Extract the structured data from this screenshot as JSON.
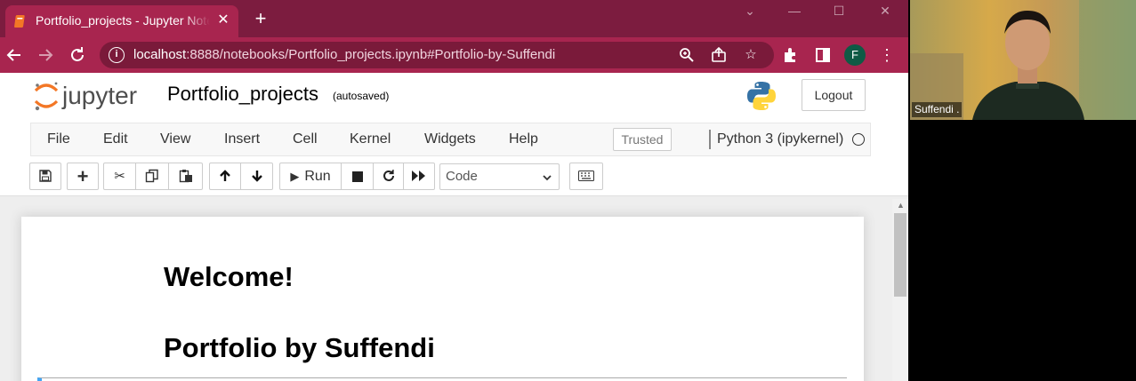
{
  "browser": {
    "tab_title": "Portfolio_projects - Jupyter Notebook",
    "new_tab": "+",
    "url_host": "localhost",
    "url_rest": ":8888/notebooks/Portfolio_projects.ipynb#Portfolio-by-Suffendi",
    "profile_initial": "F",
    "accent_color": "#a8254f",
    "tabbar_color": "#7c1c3f"
  },
  "jupyter": {
    "logo_text": "jupyter",
    "notebook_name": "Portfolio_projects",
    "autosave_status": "(autosaved)",
    "logout_label": "Logout",
    "menu": [
      "File",
      "Edit",
      "View",
      "Insert",
      "Cell",
      "Kernel",
      "Widgets",
      "Help"
    ],
    "trusted_label": "Trusted",
    "kernel_name": "Python 3 (ipykernel)",
    "toolbar": {
      "run_label": "Run",
      "cell_type": "Code"
    }
  },
  "notebook": {
    "heading_1": "Welcome!",
    "heading_2": "Portfolio by Suffendi"
  },
  "webcam": {
    "participant_name": "Suffendi ."
  }
}
